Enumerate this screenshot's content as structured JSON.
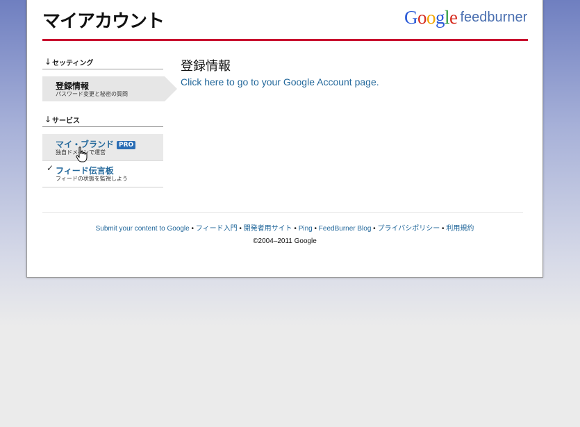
{
  "header": {
    "title": "マイアカウント",
    "logo_google": [
      "G",
      "o",
      "o",
      "g",
      "l",
      "e"
    ],
    "logo_google_colors": [
      "#2a5ad7",
      "#d62d20",
      "#f2a600",
      "#2a5ad7",
      "#2b9b3c",
      "#d62d20"
    ],
    "logo_product": "feedburner"
  },
  "sidebar": {
    "settings_header": "セッティング",
    "settings_arrow": "↓",
    "registration": {
      "title": "登録情報",
      "subtitle": "パスワード変更と秘密の質問"
    },
    "services_header": "サービス",
    "services_arrow": "↓",
    "my_brand": {
      "title": "マイ・ブランド",
      "badge": "PRO",
      "subtitle": "独自ドメインで運営"
    },
    "feed_board": {
      "check": "✓",
      "title": "フィード伝言板",
      "subtitle": "フィードの状態を監視しよう"
    }
  },
  "main": {
    "heading": "登録情報",
    "account_link": "Click here to go to your Google Account page."
  },
  "footer": {
    "links": [
      "Submit your content to Google",
      "フィード入門",
      "開発者用サイト",
      "Ping",
      "FeedBurner Blog",
      "プライバシポリシー",
      "利用規約"
    ],
    "separator": " • ",
    "copyright": "©2004–2011 Google"
  },
  "colors": {
    "accent_red": "#c8102e",
    "link_blue": "#23689b",
    "pro_badge": "#2a6db5"
  }
}
